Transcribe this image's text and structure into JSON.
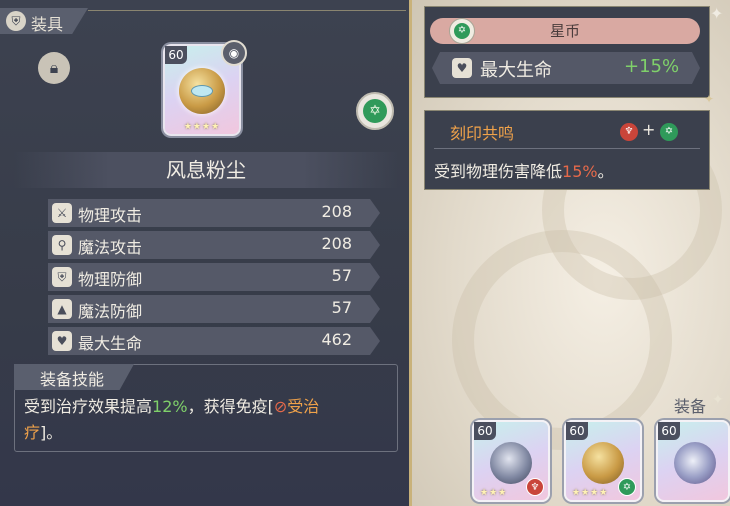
{
  "panel": {
    "title": "装具",
    "header_icon": "shield-icon",
    "lock_icon": "lock-icon"
  },
  "item": {
    "level": "60",
    "name": "风息粉尘",
    "stars": "★★★★",
    "rune_icon": "green-rune-icon"
  },
  "stats": [
    {
      "label": "物理攻击",
      "value": "208",
      "icon": "sword-icon",
      "glyph": "⚔"
    },
    {
      "label": "魔法攻击",
      "value": "208",
      "icon": "wand-icon",
      "glyph": "⚲"
    },
    {
      "label": "物理防御",
      "value": "57",
      "icon": "shield-icon",
      "glyph": "⛨"
    },
    {
      "label": "魔法防御",
      "value": "57",
      "icon": "wizard-hat-icon",
      "glyph": "▲"
    },
    {
      "label": "最大生命",
      "value": "462",
      "icon": "heart-icon",
      "glyph": "♥"
    }
  ],
  "skill": {
    "title": "装备技能",
    "text_a": "受到治疗效果提高",
    "text_b": "12%",
    "text_c": "，获得免疫[",
    "text_d": "⊘",
    "text_e": "受治",
    "text_f": "疗",
    "text_g": "]。"
  },
  "star_coin": {
    "title": "星币",
    "stat_label": "最大生命",
    "stat_value": "+15%"
  },
  "resonance": {
    "title": "刻印共鸣",
    "plus": "+",
    "text_a": "受到物理伤害降低",
    "text_b": "15%",
    "text_c": "。"
  },
  "equip_section": {
    "label": "装备",
    "slots": [
      {
        "level": "60",
        "stars": "★★★",
        "rune": "red-rune-icon"
      },
      {
        "level": "60",
        "stars": "★★★★",
        "rune": "green-rune-icon"
      },
      {
        "level": "60",
        "stars": "",
        "rune": ""
      }
    ]
  },
  "colors": {
    "panel_bg": "#3d4250",
    "accent_gold": "#c9b27a",
    "green": "#7fd06a",
    "orange": "#f0a24a",
    "red": "#e5694a",
    "rune_green": "#2f9a5a",
    "rune_red": "#c9453a"
  }
}
